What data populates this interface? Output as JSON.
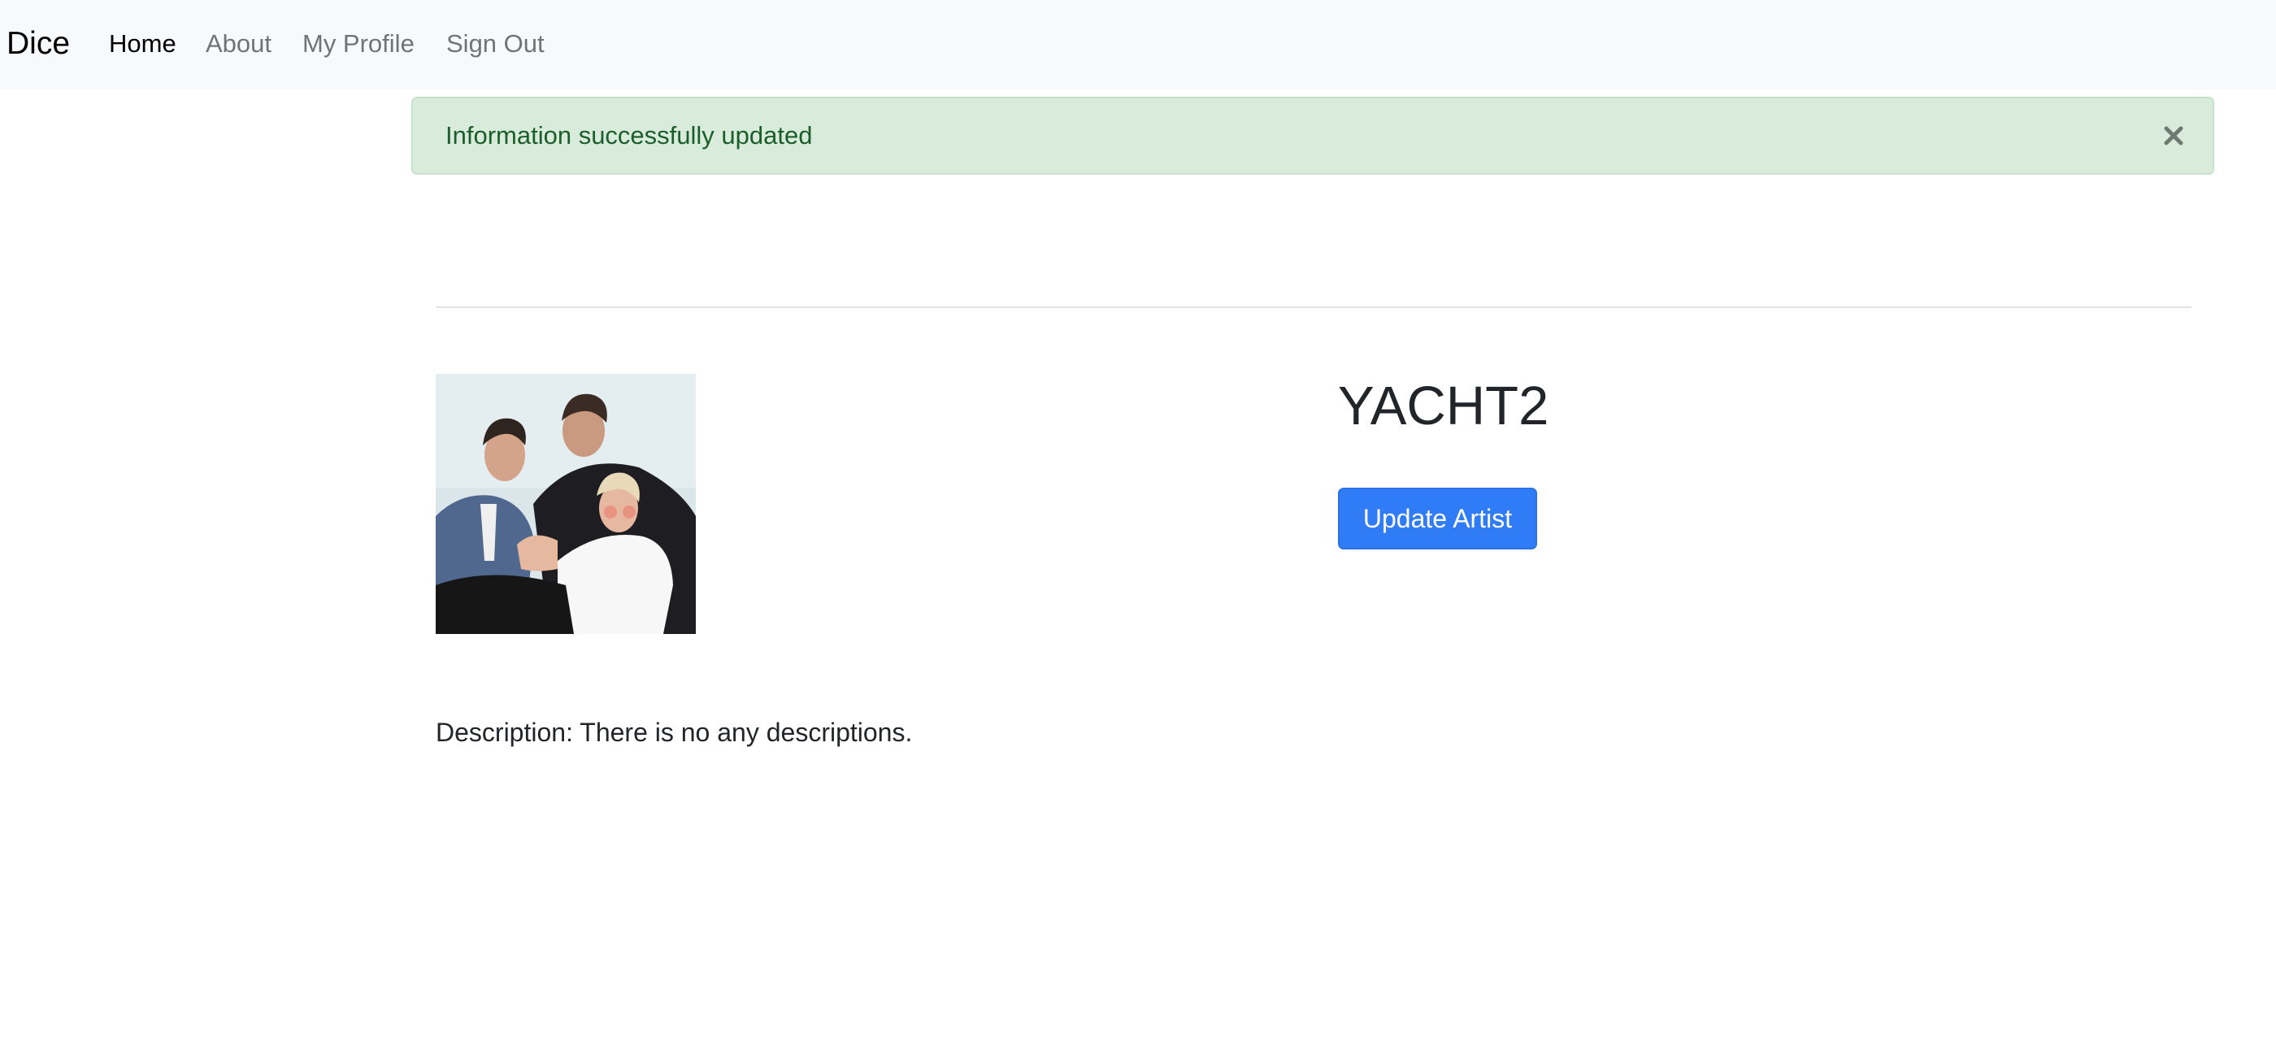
{
  "navbar": {
    "brand": "Dice",
    "links": [
      {
        "label": "Home",
        "active": true
      },
      {
        "label": "About",
        "active": false
      },
      {
        "label": "My Profile",
        "active": false
      },
      {
        "label": "Sign Out",
        "active": false
      }
    ]
  },
  "alert": {
    "message": "Information successfully updated",
    "close_icon": "close-icon",
    "background": "#d9ecdc",
    "text_color": "#1b5e2b"
  },
  "artist": {
    "name": "YACHT2",
    "image_icon": "artist-photo",
    "update_button_label": "Update Artist",
    "description": "Description: There is no any descriptions."
  },
  "colors": {
    "primary": "#2f7cf6",
    "navbar_bg": "#f8f9fa",
    "nav_inactive": "#737373"
  }
}
